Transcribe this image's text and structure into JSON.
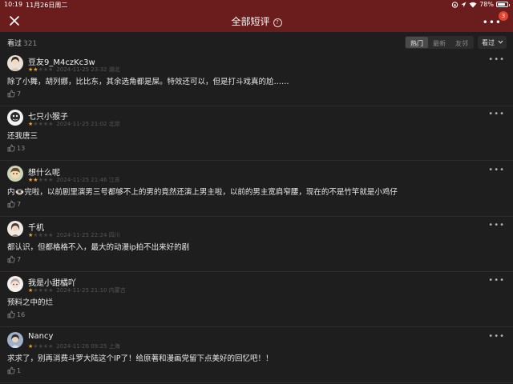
{
  "status": {
    "time": "10:19",
    "date": "11月26日周二",
    "battery": "78%",
    "battery_level": 0.78
  },
  "header": {
    "title": "全部短评",
    "help": "?",
    "more": "•••",
    "badge": "3"
  },
  "filter": {
    "count_label": "看过",
    "count": "321",
    "tabs": [
      "热门",
      "最新",
      "友邻"
    ],
    "sort_label": "看过"
  },
  "reviews": [
    {
      "user": "豆友9_M4czKc3w",
      "rating": 2,
      "time": "2024-11-25 23:32",
      "location": "湖北",
      "text": "除了小舞，胡列娜，比比东，其余选角都是屎。特效还可以，但是打斗戏真的尬……",
      "likes": "7"
    },
    {
      "user": "七只小猴子",
      "rating": 1,
      "time": "2024-11-25 21:02",
      "location": "北京",
      "text": "还我唐三",
      "likes": "13"
    },
    {
      "user": "想什么呢",
      "rating": 2,
      "time": "2024-11-25 21:46",
      "location": "江苏",
      "text": "内👁️完啦，以前剧里演男三号都够不上的男的竟然还演上男主啦，以前的男主宽肩窄腰，现在的不是竹竿就是小鸡仔",
      "likes": "7"
    },
    {
      "user": "千机",
      "rating": 1,
      "time": "2024-11-25 22:24",
      "location": "四川",
      "text": "都认识，但都格格不入，最大的动漫ip拍不出来好的剧",
      "likes": "7"
    },
    {
      "user": "我是小甜橘吖",
      "rating": 1,
      "time": "2024-11-25 21:10",
      "location": "内蒙古",
      "text": "预料之中的烂",
      "likes": "16"
    },
    {
      "user": "Nancy",
      "rating": 1,
      "time": "2024-11-26 09:25",
      "location": "上海",
      "text": "求求了，别再消费斗罗大陆这个IP了！给原著和漫画党留下点美好的回忆吧！！",
      "likes": "1"
    }
  ],
  "colors": {
    "header_bg": "#6b1d1e",
    "page_bg": "#1e1e1e",
    "star_on": "#f2a33a",
    "badge": "#e0452f"
  }
}
